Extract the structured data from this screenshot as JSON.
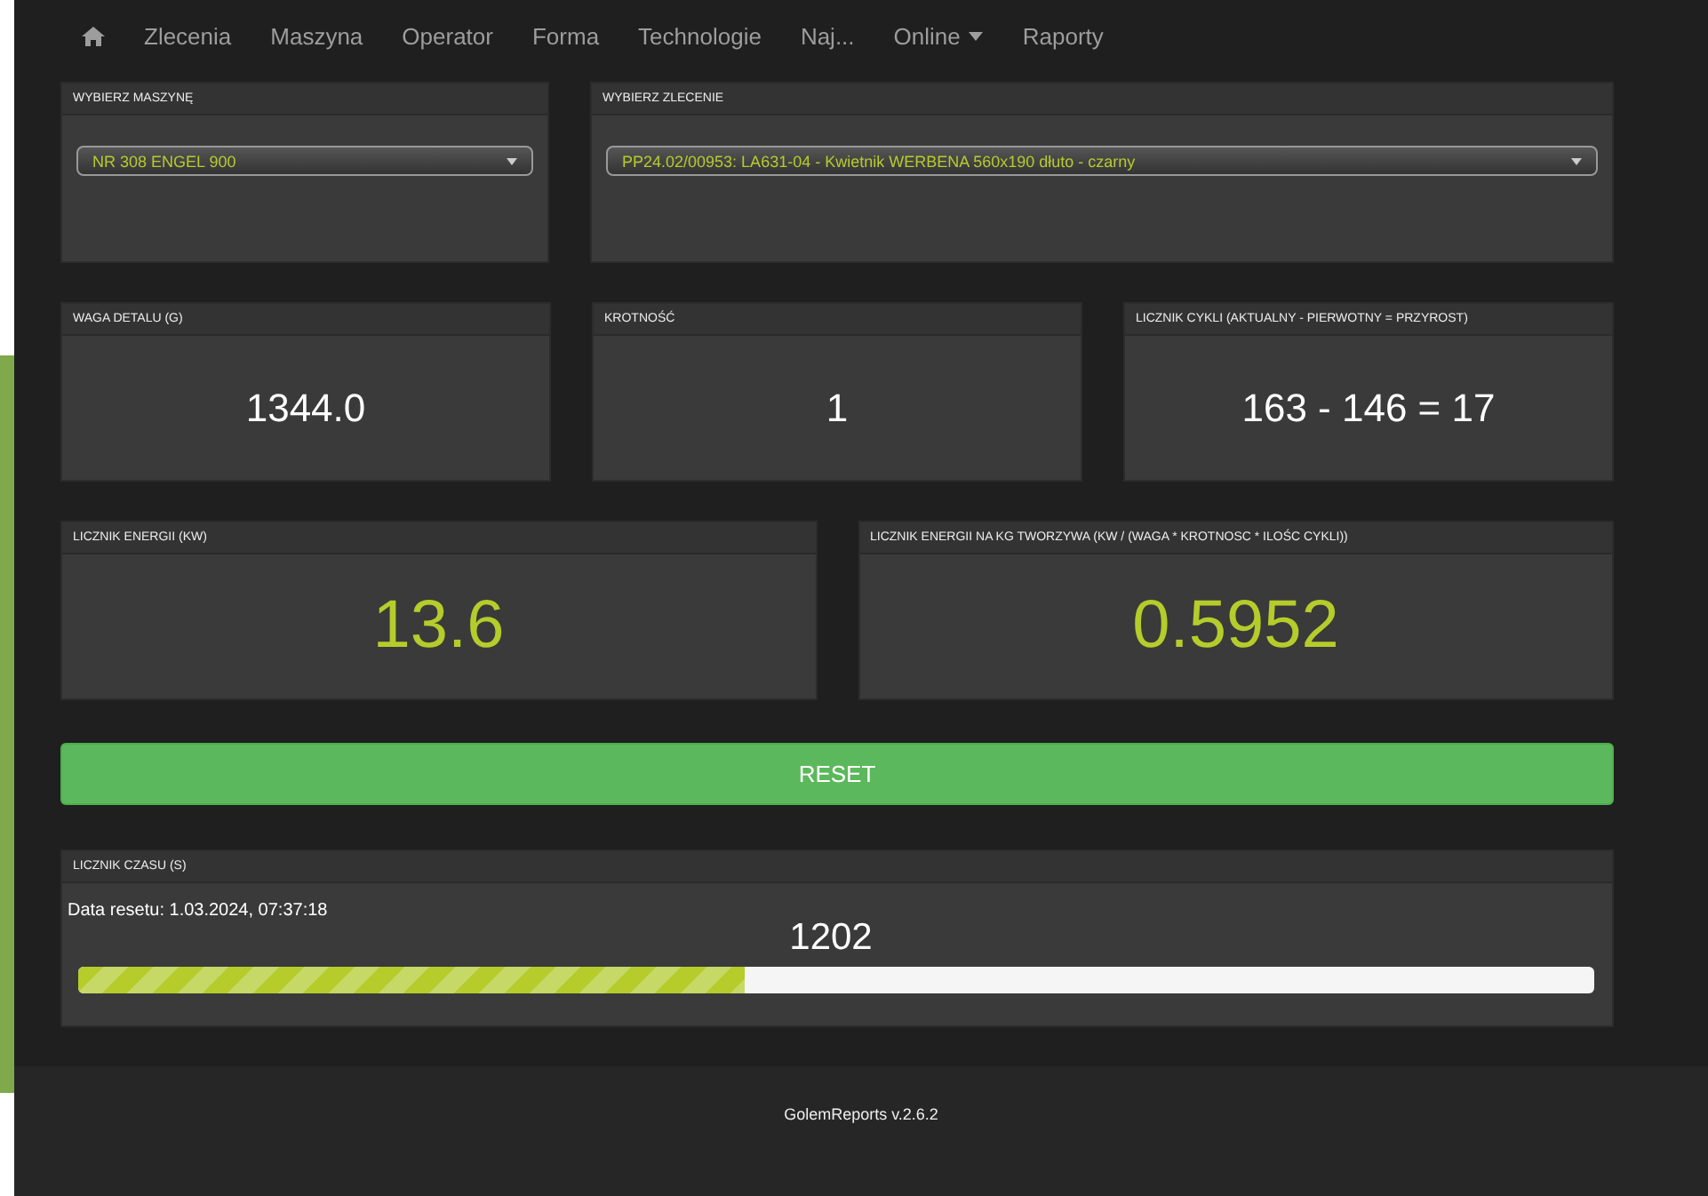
{
  "nav": {
    "items": [
      {
        "kind": "home"
      },
      {
        "kind": "link",
        "label": "Zlecenia"
      },
      {
        "kind": "link",
        "label": "Maszyna"
      },
      {
        "kind": "link",
        "label": "Operator"
      },
      {
        "kind": "link",
        "label": "Forma"
      },
      {
        "kind": "link",
        "label": "Technologie"
      },
      {
        "kind": "link",
        "label": "Naj..."
      },
      {
        "kind": "dropdown",
        "label": "Online"
      },
      {
        "kind": "link",
        "label": "Raporty"
      }
    ]
  },
  "selects": [
    {
      "title": "WYBIERZ MASZYNĘ",
      "value": "NR 308 ENGEL 900"
    },
    {
      "title": "WYBIERZ ZLECENIE",
      "value": "PP24.02/00953: LA631-04 - Kwietnik WERBENA 560x190 dłuto - czarny"
    }
  ],
  "stats": [
    {
      "title": "WAGA DETALU (G)",
      "value": "1344.0"
    },
    {
      "title": "KROTNOŚĆ",
      "value": "1"
    },
    {
      "title": "LICZNIK CYKLI (AKTUALNY - PIERWOTNY = PRZYROST)",
      "value": "163 - 146 = 17"
    }
  ],
  "energy": [
    {
      "title": "LICZNIK ENERGII (KW)",
      "value": "13.6"
    },
    {
      "title": "LICZNIK ENERGII NA KG TWORZYWA (KW / (WAGA * KROTNOSC * ILOŚC CYKLI))",
      "value": "0.5952"
    }
  ],
  "reset_button": "RESET",
  "timer": {
    "title": "LICZNIK CZASU (S)",
    "reset_date": "Data resetu: 1.03.2024, 07:37:18",
    "value": "1202",
    "level": 0.44
  },
  "footer": "GolemReports v.2.6.2"
}
